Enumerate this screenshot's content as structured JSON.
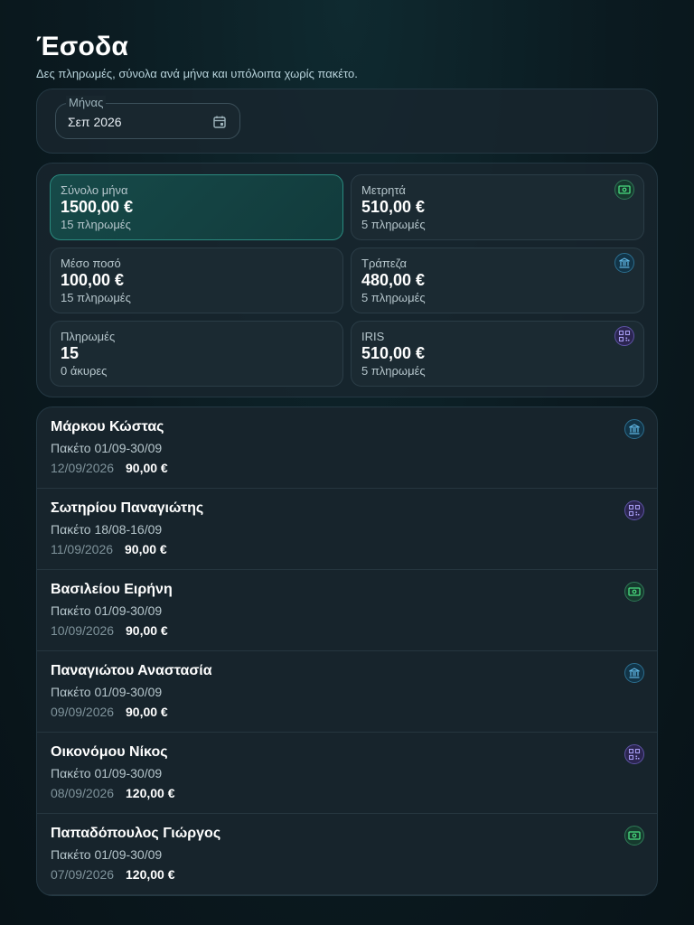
{
  "header": {
    "title": "Έσοδα",
    "subtitle": "Δες πληρωμές, σύνολα ανά μήνα και υπόλοιπα χωρίς πακέτο."
  },
  "filter": {
    "month_label": "Μήνας",
    "month_value": "Σεπ 2026",
    "calendar_icon": "calendar-icon"
  },
  "stats": {
    "total": {
      "label": "Σύνολο μήνα",
      "value": "1500,00 €",
      "sub": "15 πληρωμές"
    },
    "cash": {
      "label": "Μετρητά",
      "value": "510,00 €",
      "sub": "5 πληρωμές",
      "icon": "cash-icon"
    },
    "average": {
      "label": "Μέσο ποσό",
      "value": "100,00 €",
      "sub": "15 πληρωμές"
    },
    "bank": {
      "label": "Τράπεζα",
      "value": "480,00 €",
      "sub": "5 πληρωμές",
      "icon": "bank-icon"
    },
    "payments": {
      "label": "Πληρωμές",
      "value": "15",
      "sub": "0 άκυρες"
    },
    "iris": {
      "label": "IRIS",
      "value": "510,00 €",
      "sub": "5 πληρωμές",
      "icon": "qr-icon"
    }
  },
  "colors": {
    "cash": "#4ade80",
    "bank": "#60b8e6",
    "qr": "#a59bf0",
    "highlight": "#2a8a7f"
  },
  "payments": [
    {
      "name": "Μάρκου Κώστας",
      "package": "Πακέτο 01/09-30/09",
      "date": "12/09/2026",
      "amount": "90,00 €",
      "method": "bank"
    },
    {
      "name": "Σωτηρίου Παναγιώτης",
      "package": "Πακέτο 18/08-16/09",
      "date": "11/09/2026",
      "amount": "90,00 €",
      "method": "qr"
    },
    {
      "name": "Βασιλείου Ειρήνη",
      "package": "Πακέτο 01/09-30/09",
      "date": "10/09/2026",
      "amount": "90,00 €",
      "method": "cash"
    },
    {
      "name": "Παναγιώτου Αναστασία",
      "package": "Πακέτο 01/09-30/09",
      "date": "09/09/2026",
      "amount": "90,00 €",
      "method": "bank"
    },
    {
      "name": "Οικονόμου Νίκος",
      "package": "Πακέτο 01/09-30/09",
      "date": "08/09/2026",
      "amount": "120,00 €",
      "method": "qr"
    },
    {
      "name": "Παπαδόπουλος Γιώργος",
      "package": "Πακέτο 01/09-30/09",
      "date": "07/09/2026",
      "amount": "120,00 €",
      "method": "cash"
    }
  ]
}
